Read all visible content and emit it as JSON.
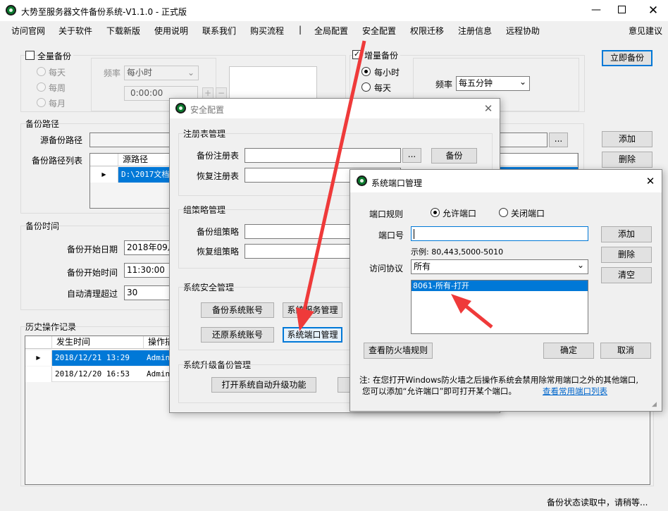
{
  "window": {
    "title": "大势至服务器文件备份系统-V1.1.0 - 正式版"
  },
  "menu": {
    "items": [
      "访问官网",
      "关于软件",
      "下载新版",
      "使用说明",
      "联系我们",
      "购买流程",
      "|",
      "全局配置",
      "安全配置",
      "权限迁移",
      "注册信息",
      "远程协助"
    ],
    "feedback": "意见建议"
  },
  "full_backup": {
    "label": "全量备份",
    "options": [
      "每天",
      "每周",
      "每月"
    ],
    "freq_label": "频率",
    "freq_value": "每小时",
    "time_value": "0:00:00",
    "plus": "+",
    "minus": "−"
  },
  "inc_backup": {
    "label": "增量备份",
    "options": [
      "每小时",
      "每天"
    ],
    "freq_label": "频率",
    "freq_value": "每五分钟"
  },
  "backup_now": "立即备份",
  "path": {
    "section": "备份路径",
    "source_label": "源备份路径",
    "browse": "...",
    "list_label": "备份路径列表",
    "col": "源路径",
    "row": "D:\\2017文档",
    "add": "添加",
    "delete": "删除"
  },
  "time": {
    "section": "备份时间",
    "start_date_label": "备份开始日期",
    "start_date": "2018年09月",
    "start_time_label": "备份开始时间",
    "start_time": "11:30:00",
    "cleanup_label": "自动清理超过",
    "cleanup_value": "30"
  },
  "history": {
    "section": "历史操作记录",
    "cols": [
      "发生时间",
      "操作描"
    ],
    "rows": [
      {
        "time": "2018/12/21 13:29",
        "op": "Admin"
      },
      {
        "time": "2018/12/20 16:53",
        "op": "Admin"
      }
    ]
  },
  "security": {
    "title": "安全配置",
    "registry": {
      "section": "注册表管理",
      "backup_label": "备份注册表",
      "restore_label": "恢复注册表",
      "browse": "...",
      "backup_btn": "备份"
    },
    "policy": {
      "section": "组策略管理",
      "backup_label": "备份组策略",
      "restore_label": "恢复组策略"
    },
    "system": {
      "section": "系统安全管理",
      "backup_account": "备份系统账号",
      "restore_account": "还原系统账号",
      "service": "系统服务管理",
      "port": "系统端口管理"
    },
    "upgrade": {
      "section": "系统升级备份管理",
      "open_btn": "打开系统自动升级功能"
    }
  },
  "port": {
    "title": "系统端口管理",
    "rule_label": "端口规则",
    "allow": "允许端口",
    "close": "关闭端口",
    "port_label": "端口号",
    "port_value": "",
    "example": "示例: 80,443,5000-5010",
    "protocol_label": "访问协议",
    "protocol_value": "所有",
    "list_item": "8061-所有-打开",
    "add": "添加",
    "delete": "删除",
    "clear": "清空",
    "firewall_btn": "查看防火墙规则",
    "ok": "确定",
    "cancel": "取消",
    "note1": "注: 在您打开Windows防火墙之后操作系统会禁用除常用端口之外的其他端口,",
    "note2": "您可以添加“允许端口”即可打开某个端口。",
    "link": "查看常用端口列表"
  },
  "status": {
    "text": "备份状态读取中，请稍等..."
  },
  "colors": {
    "selection": "#0078d7",
    "row_selected": "#cce8ff",
    "annotation_arrow": "#ef3a3a",
    "link": "#0066cc"
  }
}
